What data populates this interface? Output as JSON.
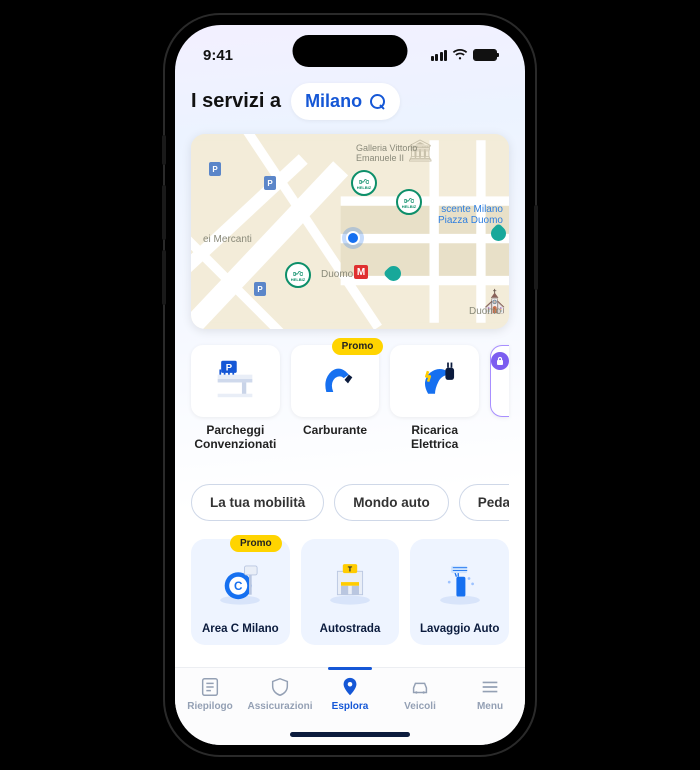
{
  "status": {
    "time": "9:41"
  },
  "header": {
    "prefix": "I servizi a",
    "city": "Milano"
  },
  "map": {
    "labels": {
      "galleria_l1": "Galleria Vittorio",
      "galleria_l2": "Emanuele II",
      "mercanti": "ei Mercanti",
      "duomo": "Duomo",
      "duomo_area": "Duomo",
      "rinascente_l1": "scente Milano",
      "rinascente_l2": "Piazza Duomo"
    },
    "pin_brand": "HELBIZ",
    "metro": "M",
    "parking": "P"
  },
  "services": [
    {
      "label_l1": "Parcheggi",
      "label_l2": "Convenzionati",
      "promo": false
    },
    {
      "label_l1": "Carburante",
      "label_l2": "",
      "promo": true
    },
    {
      "label_l1": "Ricarica",
      "label_l2": "Elettrica",
      "promo": false
    }
  ],
  "promo_label": "Promo",
  "tags": [
    "La tua mobilità",
    "Mondo auto",
    "Pedaggi"
  ],
  "tiles": [
    {
      "label": "Area C Milano",
      "promo": true
    },
    {
      "label": "Autostrada",
      "promo": false
    },
    {
      "label": "Lavaggio Auto",
      "promo": false
    }
  ],
  "tabs": {
    "riepilogo": "Riepilogo",
    "assicurazioni": "Assicurazioni",
    "esplora": "Esplora",
    "veicoli": "Veicoli",
    "menu": "Menu"
  }
}
